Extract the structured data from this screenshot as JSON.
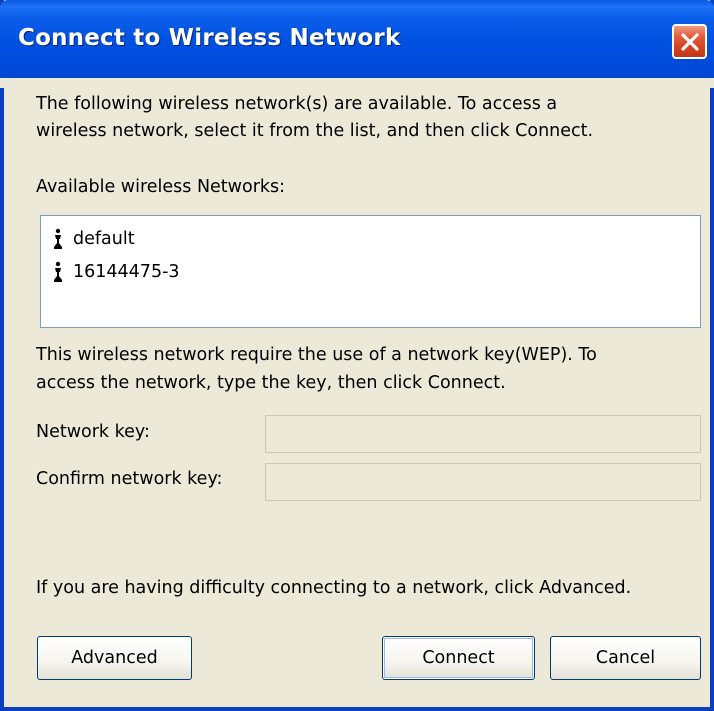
{
  "window": {
    "title": "Connect to Wireless Network"
  },
  "intro": {
    "line1": "The following wireless network(s) are available. To access a",
    "line2": "wireless network, select it from the list, and then click Connect."
  },
  "networks": {
    "label": "Available wireless Networks:",
    "items": [
      {
        "name": "default",
        "icon": "wireless-antenna-icon"
      },
      {
        "name": "16144475-3",
        "icon": "wireless-antenna-icon"
      }
    ]
  },
  "key_info": {
    "line1": "This wireless network require the use of a network key(WEP). To",
    "line2": "access the network, type the key, then click Connect."
  },
  "form": {
    "network_key_label": "Network key:",
    "network_key_value": "",
    "confirm_key_label": "Confirm network key:",
    "confirm_key_value": ""
  },
  "help": {
    "text": "If you are having difficulty connecting to a network, click Advanced."
  },
  "buttons": {
    "advanced": "Advanced",
    "connect": "Connect",
    "cancel": "Cancel"
  },
  "colors": {
    "titlebar": "#0050E0",
    "window_bg": "#ECE9D8",
    "close_button": "#D44222"
  }
}
